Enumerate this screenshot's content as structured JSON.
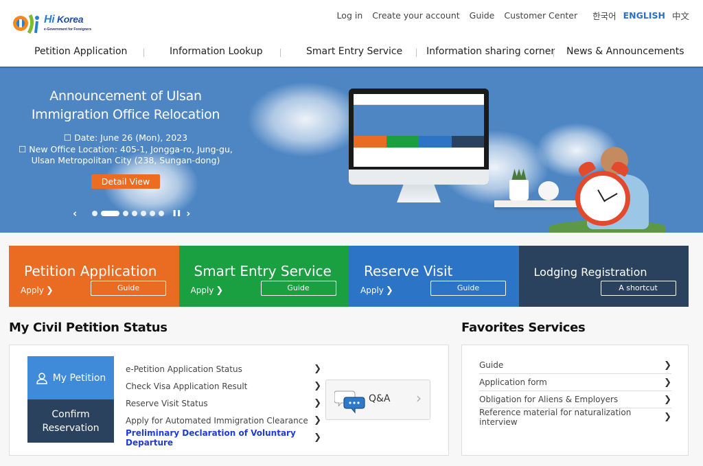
{
  "header": {
    "logo": {
      "brand": "Hi Korea",
      "brand_hi": "Hi",
      "brand_korea": "Korea",
      "tagline": "e-Government for Foreigners"
    },
    "util_links": [
      "Log in",
      "Create your account",
      "Guide",
      "Customer Center"
    ],
    "languages": [
      {
        "label": "한국어",
        "active": false
      },
      {
        "label": "ENGLISH",
        "active": true
      },
      {
        "label": "中文",
        "active": false
      }
    ],
    "gnb": [
      "Petition Application",
      "Information Lookup",
      "Smart Entry Service",
      "Information sharing corner",
      "News & Announcements"
    ]
  },
  "hero": {
    "title": "Announcement of Ulsan Immigration Office Relocation",
    "lines": [
      "☐ Date: June 26 (Mon), 2023",
      "☐ New Office Location: 405-1, Jongga-ro, Jung-gu,",
      "Ulsan Metropolitan City (238, Sungan-dong)"
    ],
    "button": "Detail View",
    "carousel": {
      "total_slides": 7,
      "active_index": 1,
      "prev_icon": "chevron-left",
      "next_icon": "chevron-right",
      "pause_icon": "pause"
    }
  },
  "tiles": [
    {
      "title": "Petition Application",
      "apply": "Apply",
      "button": "Guide",
      "color": "#ea6b22"
    },
    {
      "title": "Smart Entry Service",
      "apply": "Apply",
      "button": "Guide",
      "color": "#1a9f41"
    },
    {
      "title": "Reserve Visit",
      "apply": "Apply",
      "button": "Guide",
      "color": "#2b74c6"
    },
    {
      "title": "Lodging Registration",
      "apply": "",
      "button": "A shortcut",
      "color": "#2b425e"
    }
  ],
  "petition_status": {
    "title": "My Civil Petition Status",
    "my_petition": "My Petition",
    "confirm_reservation": "Confirm Reservation",
    "links": [
      {
        "label": "e-Petition Application Status",
        "highlight": false
      },
      {
        "label": "Check Visa Application Result",
        "highlight": false
      },
      {
        "label": "Reserve Visit Status",
        "highlight": false
      },
      {
        "label": "Apply for Automated Immigration Clearance",
        "highlight": false
      },
      {
        "label": "Preliminary Declaration of Voluntary Departure",
        "highlight": true
      }
    ],
    "qa": "Q&A"
  },
  "favorites": {
    "title": "Favorites Services",
    "links": [
      "Guide",
      "Application form",
      "Obligation for Aliens & Employers",
      "Reference material for naturalization interview"
    ]
  },
  "colors": {
    "hero_bg": "#4e86c4",
    "accent_orange": "#ec6d22",
    "link_highlight": "#1f3bd6",
    "lang_active": "#2a6fc7"
  }
}
